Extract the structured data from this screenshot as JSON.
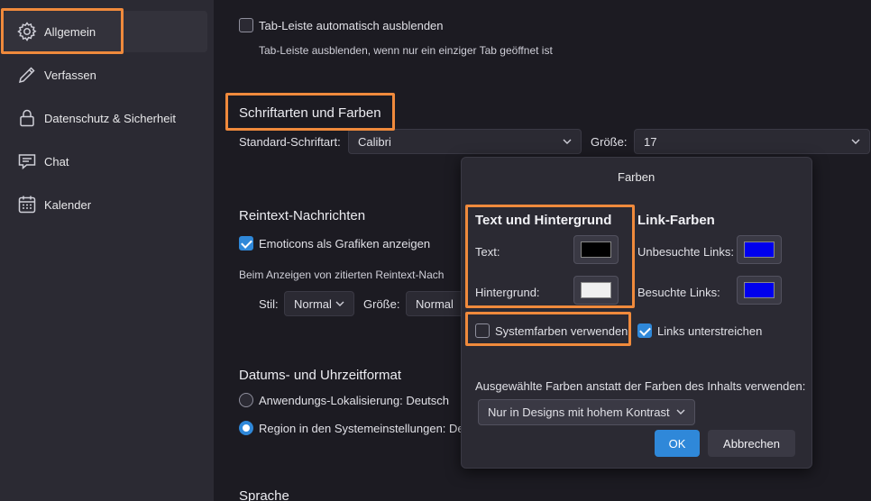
{
  "sidebar": {
    "items": [
      {
        "label": "Allgemein",
        "icon": "gear-icon"
      },
      {
        "label": "Verfassen",
        "icon": "pencil-icon"
      },
      {
        "label": "Datenschutz & Sicherheit",
        "icon": "lock-icon"
      },
      {
        "label": "Chat",
        "icon": "chat-icon"
      },
      {
        "label": "Kalender",
        "icon": "calendar-icon"
      }
    ]
  },
  "main": {
    "tabbar_checkbox_label": "Tab-Leiste automatisch ausblenden",
    "tabbar_description": "Tab-Leiste ausblenden, wenn nur ein einziger Tab geöffnet ist",
    "fonts_heading": "Schriftarten und Farben",
    "default_font_label": "Standard-Schriftart:",
    "default_font_value": "Calibri",
    "size_label": "Größe:",
    "size_value": "17",
    "plaintext_heading": "Reintext-Nachrichten",
    "emoticons_label": "Emoticons als Grafiken anzeigen",
    "quoted_text_label": "Beim Anzeigen von zitierten Reintext-Nach",
    "style_label": "Stil:",
    "style_value": "Normal",
    "quoted_size_label": "Größe:",
    "quoted_size_value": "Normal",
    "datetime_heading": "Datums- und Uhrzeitformat",
    "app_locale_label": "Anwendungs-Lokalisierung: Deutsch",
    "region_label": "Region in den Systemeinstellungen: De",
    "language_heading": "Sprache"
  },
  "dialog": {
    "title": "Farben",
    "text_bg_heading": "Text und Hintergrund",
    "text_label": "Text:",
    "background_label": "Hintergrund:",
    "link_heading": "Link-Farben",
    "unvisited_label": "Unbesuchte Links:",
    "visited_label": "Besuchte Links:",
    "system_colors_label": "Systemfarben verwenden",
    "underline_links_label": "Links unterstreichen",
    "use_colors_label": "Ausgewählte Farben anstatt der Farben des Inhalts verwenden:",
    "use_colors_value": "Nur in Designs mit hohem Kontrast",
    "ok_label": "OK",
    "cancel_label": "Abbrechen",
    "colors": {
      "text": "#000000",
      "background": "#f0f0f0",
      "unvisited": "#0000ee",
      "visited": "#0000ee"
    }
  },
  "theme": {
    "accent": "#2f88d9",
    "highlight": "#f08a3c"
  }
}
